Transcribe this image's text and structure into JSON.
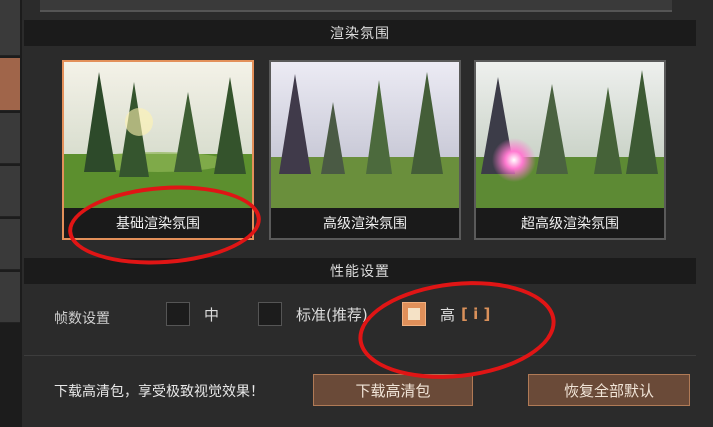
{
  "render_section": {
    "title": "渲染氛围",
    "options": [
      {
        "label": "基础渲染氛围",
        "selected": true
      },
      {
        "label": "高级渲染氛围",
        "selected": false
      },
      {
        "label": "超高级渲染氛围",
        "selected": false
      }
    ]
  },
  "performance_section": {
    "title": "性能设置",
    "fps": {
      "label": "帧数设置",
      "options": [
        {
          "label": "中",
          "checked": false
        },
        {
          "label": "标准(推荐)",
          "checked": false
        },
        {
          "label": "高",
          "checked": true
        }
      ],
      "info_bracket": "[ i ]"
    }
  },
  "footer": {
    "text": "下载高清包，享受极致视觉效果！",
    "download_button": "下载高清包",
    "reset_button": "恢复全部默认"
  },
  "colors": {
    "accent": "#e0905a",
    "annotation": "#e01515"
  }
}
